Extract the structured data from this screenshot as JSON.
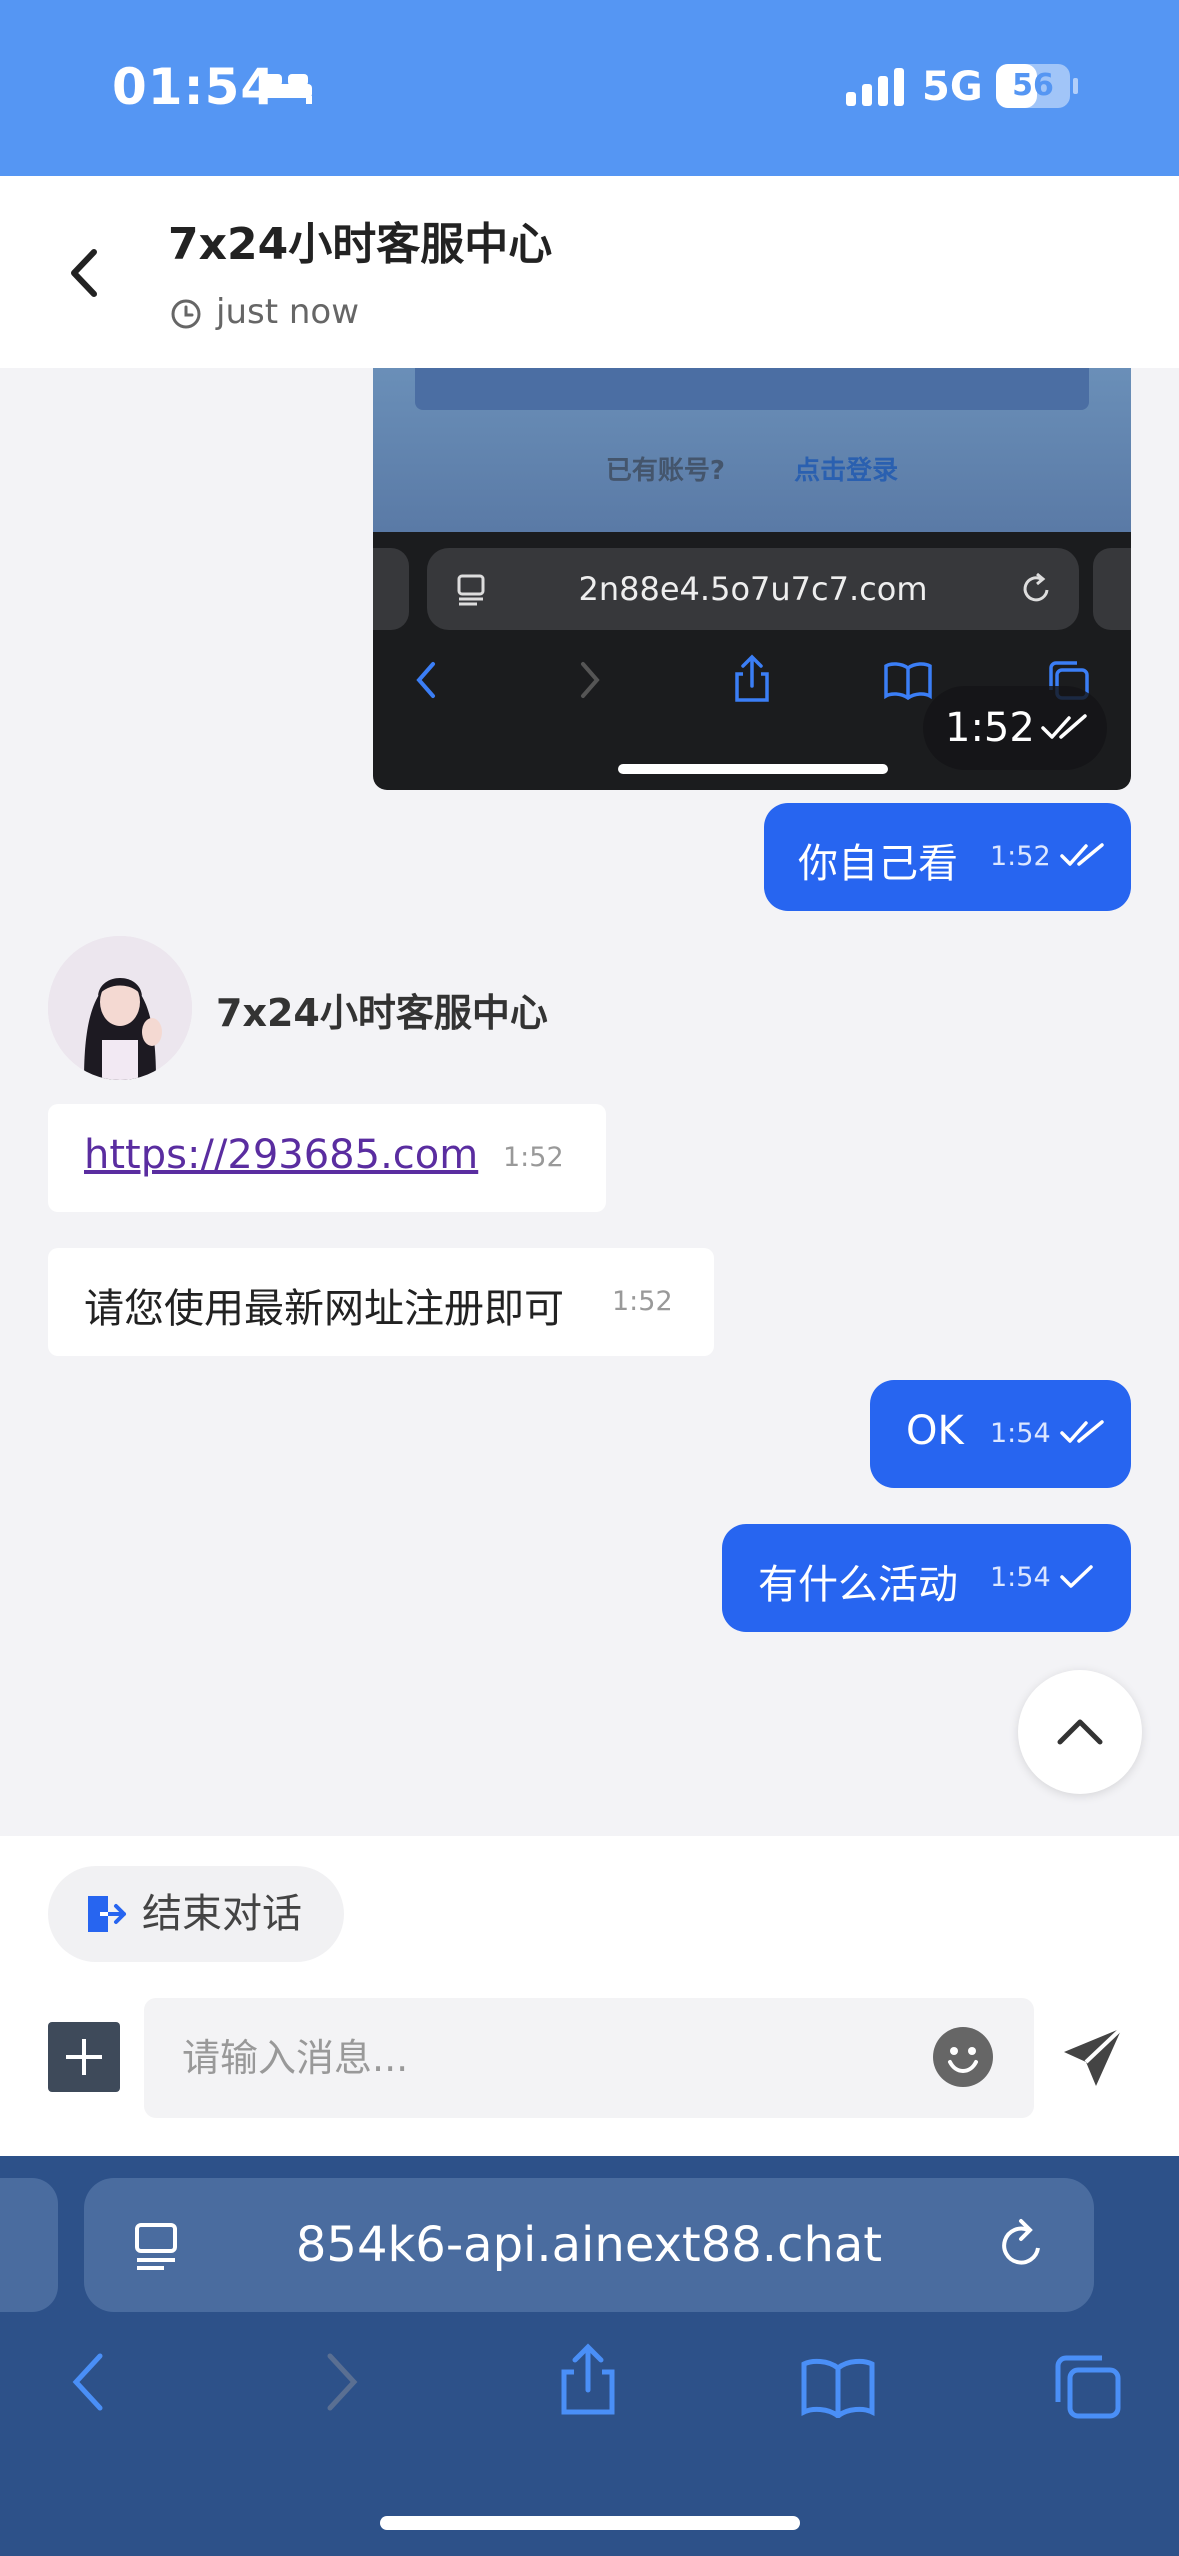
{
  "status_bar": {
    "time": "01:54",
    "network": "5G",
    "battery_level": "56",
    "battery_percent": 56
  },
  "header": {
    "title": "7x24小时客服中心",
    "subtitle": "just now"
  },
  "screenshot_message": {
    "login_prompt": "已有账号?",
    "login_link": "点击登录",
    "url": "2n88e4.5o7u7c7.com",
    "time": "1:52"
  },
  "messages": [
    {
      "text": "你自己看",
      "time": "1:52",
      "direction": "out",
      "status": "read"
    },
    {
      "text": "https://293685.com",
      "time": "1:52",
      "direction": "in"
    },
    {
      "text": "请您使用最新网址注册即可",
      "time": "1:52",
      "direction": "in"
    },
    {
      "text": "OK",
      "time": "1:54",
      "direction": "out",
      "status": "read"
    },
    {
      "text": "有什么活动",
      "time": "1:54",
      "direction": "out",
      "status": "sent"
    }
  ],
  "sender": {
    "name": "7x24小时客服中心"
  },
  "composer": {
    "end_chat_label": "结束对话",
    "input_placeholder": "请输入消息..."
  },
  "browser": {
    "url": "854k6-api.ainext88.chat"
  },
  "colors": {
    "accent": "#2765f0",
    "status_bar": "#5596f3",
    "browser_bar": "#2d5189"
  }
}
